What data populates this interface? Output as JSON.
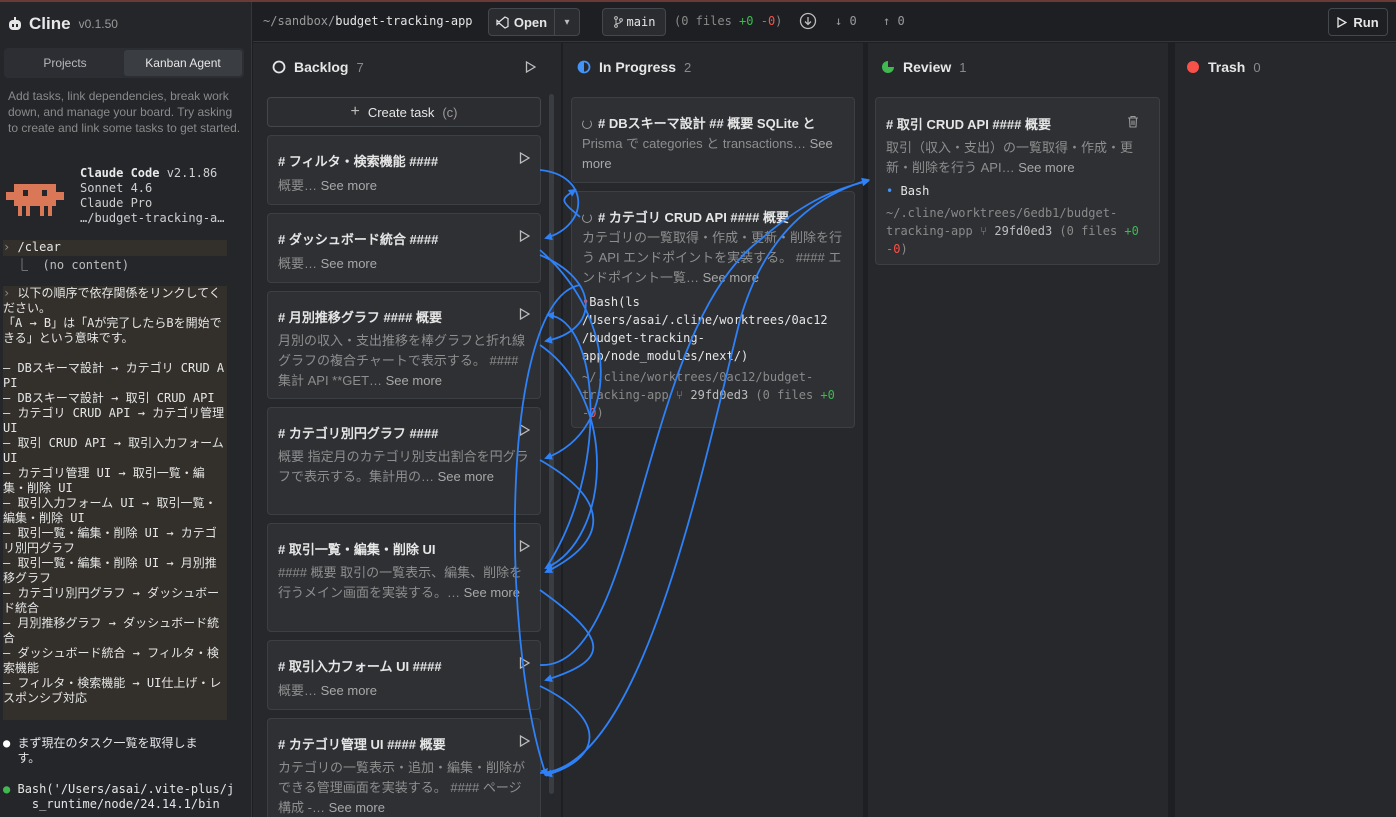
{
  "sidebar": {
    "brand": "Cline",
    "version": "v0.1.50",
    "tabs": [
      "Projects",
      "Kanban Agent"
    ],
    "help": "Add tasks, link dependencies, break work down, and manage your board. Try asking to create and link some tasks to get started.",
    "claude": {
      "name": "Claude Code",
      "ver": " v2.1.86",
      "model": "Sonnet 4.6",
      "plan": "Claude Pro",
      "dir": "…/budget-tracking-a…"
    },
    "clear_cmd": "/clear",
    "clear_result": "⎿  (no content)",
    "prompt": "以下の順序で依存関係をリンクしてください。\n「A → B」は「Aが完了したらBを開始できる」という意味です。\n\n– DBスキーマ設計 → カテゴリ CRUD API\n– DBスキーマ設計 → 取引 CRUD API\n– カテゴリ CRUD API → カテゴリ管理 UI\n– 取引 CRUD API → 取引入力フォーム UI\n– カテゴリ管理 UI → 取引一覧・編集・削除 UI\n– 取引入力フォーム UI → 取引一覧・編集・削除 UI\n– 取引一覧・編集・削除 UI → カテゴリ別円グラフ\n– 取引一覧・編集・削除 UI → 月別推移グラフ\n– カテゴリ別円グラフ → ダッシュボード統合\n– 月別推移グラフ → ダッシュボード統合\n– ダッシュボード統合 → フィルタ・検索機能\n– フィルタ・検索機能 → UI仕上げ・レスポンシブ対応",
    "msg1": "まず現在のタスク一覧を取得しま\n  す。",
    "msg2": "Bash('/Users/asai/.vite-plus/j\n    s_runtime/node/24.14.1/bin"
  },
  "topbar": {
    "path_prefix": "~/sandbox/",
    "path_name": "budget-tracking-app",
    "open_label": "Open",
    "branch": "main",
    "files_prefix": "(0 files ",
    "files_plus": "+0",
    "files_minus": "-0",
    "files_suffix": ")",
    "behind": "0",
    "ahead": "0",
    "run_label": "Run"
  },
  "columns": [
    {
      "name": "Backlog",
      "count": "7"
    },
    {
      "name": "In Progress",
      "count": "2"
    },
    {
      "name": "Review",
      "count": "1"
    },
    {
      "name": "Trash",
      "count": "0"
    }
  ],
  "colors": {
    "backlog": "#e6e6e6",
    "in_progress": "#4493f8",
    "review": "#3fb950",
    "trash": "#f85149",
    "arrow": "#2f81f7"
  },
  "create_task": {
    "label": "Create task",
    "shortcut": "(c)"
  },
  "see_more": "See more",
  "backlog_cards": [
    {
      "title": "# フィルタ・検索機能 ####",
      "desc": "概要… "
    },
    {
      "title": "# ダッシュボード統合 ####",
      "desc": "概要… "
    },
    {
      "title": "# 月別推移グラフ #### 概要",
      "desc": "月別の収入・支出推移を棒グラフと折れ線グラフの複合チャートで表示する。 #### 集計 API **GET… "
    },
    {
      "title": "# カテゴリ別円グラフ ####",
      "desc": "概要 指定月のカテゴリ別支出割合を円グラフで表示する。集計用の… "
    },
    {
      "title": "# 取引一覧・編集・削除 UI",
      "desc": "#### 概要 取引の一覧表示、編集、削除を行うメイン画面を実装する。… "
    },
    {
      "title": "# 取引入力フォーム UI ####",
      "desc": "概要… "
    },
    {
      "title": "# カテゴリ管理 UI #### 概要",
      "desc": "カテゴリの一覧表示・追加・編集・削除ができる管理画面を実装する。 #### ページ構成 -… "
    }
  ],
  "progress_cards": [
    {
      "title": "# DBスキーマ設計 ## 概要 SQLite と",
      "desc": "Prisma で categories と transactions… "
    },
    {
      "title": "# カテゴリ CRUD API #### 概要",
      "desc": "カテゴリの一覧取得・作成・更新・削除を行う API エンドポイントを実装する。 #### エンドポイント一覧… ",
      "cmd": "Bash(ls\n/Users/asai/.cline/worktrees/0ac12\n/budget-tracking-\napp/node_modules/next/)",
      "worktree": "~/.cline/worktrees/0ac12/budget-tracking-app",
      "commit": "29fd0ed3",
      "files_prefix": " (0 files ",
      "files_plus": "+0",
      "files_minus": "-0",
      "files_suffix": ")"
    }
  ],
  "review_cards": [
    {
      "title": "# 取引 CRUD API #### 概要",
      "desc": "取引（収入・支出）の一覧取得・作成・更新・削除を行う API… ",
      "tool": "Bash",
      "worktree": "~/.cline/worktrees/6edb1/budget-tracking-app",
      "commit": "29fd0ed3",
      "files_prefix": " (0 files ",
      "files_plus": "+0",
      "files_minus": "-0",
      "files_suffix": ")"
    }
  ]
}
